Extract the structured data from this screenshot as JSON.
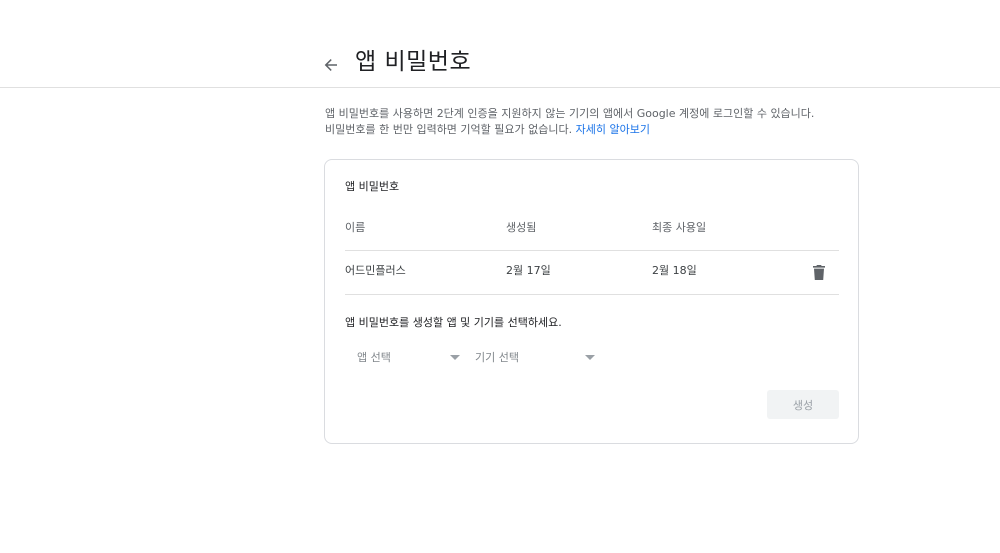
{
  "header": {
    "title": "앱 비밀번호",
    "back_icon": "arrow-left-icon"
  },
  "description": {
    "line1": "앱 비밀번호를 사용하면 2단계 인증을 지원하지 않는 기기의 앱에서 Google 계정에 로그인할 수 있습니다.",
    "line2": "비밀번호를 한 번만 입력하면 기억할 필요가 없습니다.",
    "learn_more": "자세히 알아보기"
  },
  "card": {
    "title": "앱 비밀번호",
    "columns": [
      "이름",
      "생성됨",
      "최종 사용일"
    ],
    "rows": [
      {
        "name": "어드민플러스",
        "created": "2월 17일",
        "last_used": "2월 18일",
        "action_icon": "trash-icon"
      }
    ],
    "prompt": "앱 비밀번호를 생성할 앱 및 기기를 선택하세요.",
    "app_select": "앱 선택",
    "device_select": "기기 선택",
    "generate_button": "생성"
  },
  "colors": {
    "link": "#1a73e8",
    "border": "#dadce0",
    "disabled_button_bg": "#f1f3f4"
  }
}
